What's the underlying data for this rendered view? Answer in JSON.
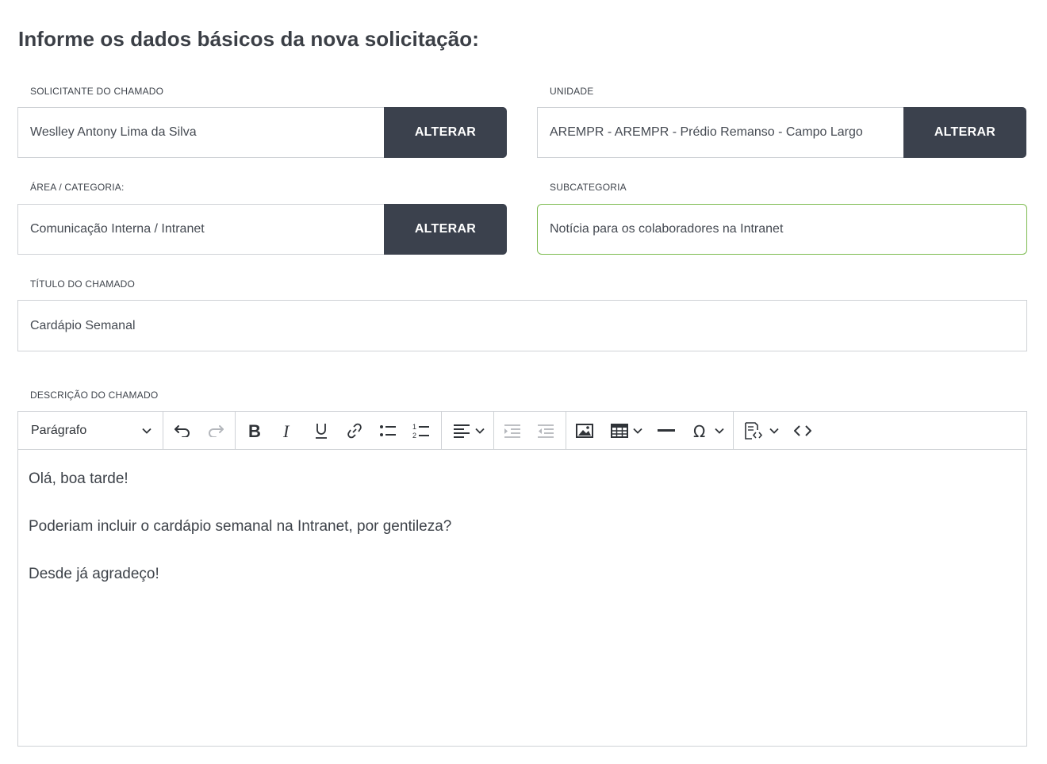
{
  "page": {
    "title": "Informe os dados básicos da nova solicitação:"
  },
  "form": {
    "requester": {
      "label": "SOLICITANTE DO CHAMADO",
      "value": "Weslley Antony Lima da Silva",
      "button": "ALTERAR"
    },
    "unit": {
      "label": "UNIDADE",
      "value": "AREMPR - AREMPR - Prédio Remanso - Campo Largo",
      "button": "ALTERAR"
    },
    "category": {
      "label": "ÁREA / CATEGORIA:",
      "value": "Comunicação Interna / Intranet",
      "button": "ALTERAR"
    },
    "subcategory": {
      "label": "SUBCATEGORIA",
      "value": "Notícia para os colaboradores na Intranet"
    },
    "ticket_title": {
      "label": "TÍTULO DO CHAMADO",
      "value": "Cardápio Semanal"
    },
    "description": {
      "label": "DESCRIÇÃO DO CHAMADO",
      "paragraph_style": "Parágrafo",
      "toolbar_icons": [
        "chevron-down-icon",
        "undo-icon",
        "redo-icon",
        "bold-icon",
        "italic-icon",
        "underline-icon",
        "link-icon",
        "bulleted-list-icon",
        "numbered-list-icon",
        "align-icon",
        "outdent-icon",
        "indent-icon",
        "image-icon",
        "table-icon",
        "horizontal-line-icon",
        "special-characters-icon",
        "source-code-icon",
        "html-embed-icon"
      ],
      "paragraphs": [
        "Olá, boa tarde!",
        "Poderiam incluir o cardápio semanal na Intranet, por gentileza?",
        "Desde já agradeço!"
      ]
    }
  },
  "colors": {
    "button_bg": "#3b414d",
    "button_text": "#ffffff",
    "border": "#cfd2d6",
    "valid_border": "#7cbb4f",
    "text": "#3a3f47"
  }
}
